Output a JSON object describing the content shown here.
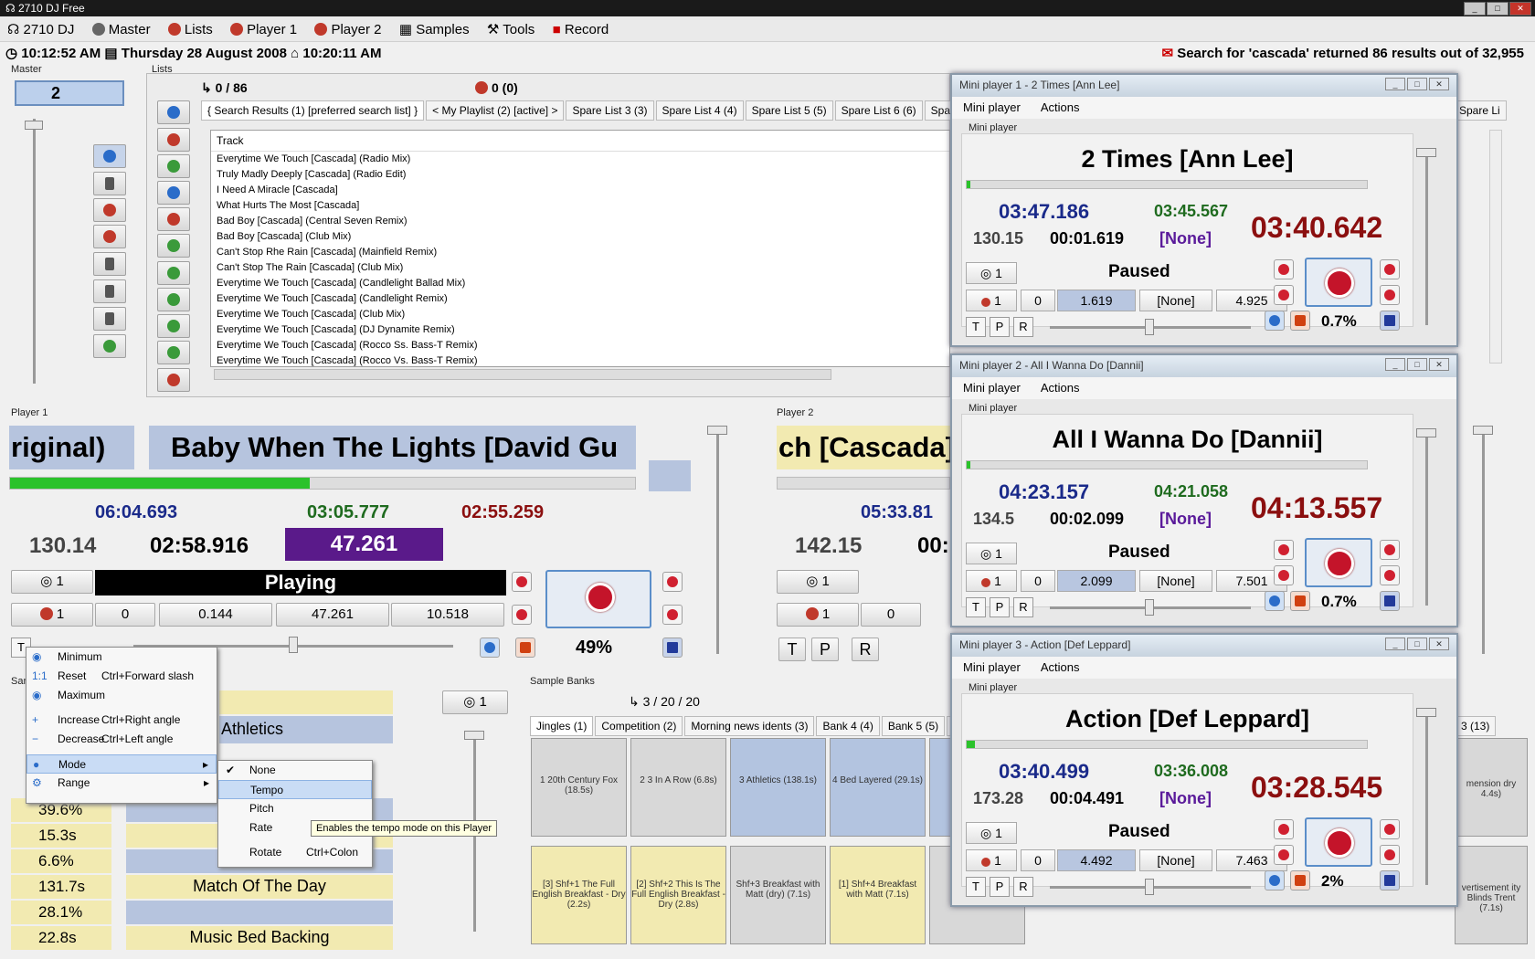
{
  "app": {
    "title": "2710 DJ Free"
  },
  "menu": [
    "2710 DJ",
    "Master",
    "Lists",
    "Player 1",
    "Player 2",
    "Samples",
    "Tools",
    "Record"
  ],
  "status": {
    "time1": "10:12:52 AM",
    "date": "Thursday 28 August 2008",
    "time2": "10:20:11 AM",
    "search": "Search for 'cascada' returned 86 results out of 32,955"
  },
  "master": {
    "label": "Master",
    "value": "2"
  },
  "lists": {
    "label": "Lists",
    "count": "0 / 86",
    "count2": "0 (0)",
    "tabs": [
      "{ Search Results (1) [preferred search list] }",
      "< My Playlist (2) [active] >",
      "Spare List 3 (3)",
      "Spare List 4 (4)",
      "Spare List 5 (5)",
      "Spare List 6 (6)",
      "Spare List"
    ],
    "tab_right": "Spare Li",
    "column": "Track",
    "tracks": [
      "Everytime We Touch [Cascada] (Radio Mix)",
      "Truly Madly Deeply [Cascada] (Radio Edit)",
      "I Need A Miracle [Cascada]",
      "What Hurts The Most [Cascada]",
      "Bad Boy [Cascada] (Central Seven Remix)",
      "Bad Boy [Cascada] (Club Mix)",
      "Can't Stop Rhe Rain [Cascada] (Mainfield Remix)",
      "Can't Stop The Rain [Cascada] (Club Mix)",
      "Everytime We Touch [Cascada] (Candlelight Ballad Mix)",
      "Everytime We Touch [Cascada] (Candlelight Remix)",
      "Everytime We Touch [Cascada] (Club Mix)",
      "Everytime We Touch [Cascada] (DJ Dynamite Remix)",
      "Everytime We Touch [Cascada] (Rocco Ss. Bass-T Remix)",
      "Everytime We Touch [Cascada] (Rocco Vs. Bass-T Remix)"
    ]
  },
  "player1": {
    "label": "Player 1",
    "title_left": "riginal)",
    "title": "Baby When The Lights [David Gu",
    "progress": 0.48,
    "t1": "06:04.693",
    "t2": "03:05.777",
    "bpm": "130.14",
    "t3": "02:58.916",
    "cue": "47.261",
    "remain": "02:55.259",
    "cue_num": "1",
    "state": "Playing",
    "c1": "1",
    "c2": "0",
    "c3": "0.144",
    "c4": "47.261",
    "c5": "10.518",
    "percent": "49%",
    "tpr": [
      "T",
      "P",
      "R"
    ]
  },
  "player2": {
    "label": "Player 2",
    "title": "ch [Cascada]",
    "t1": "05:33.81",
    "bpm": "142.15",
    "t3": "00:",
    "cue_num": "1",
    "c1": "1",
    "c2": "0",
    "tpr": [
      "T",
      "P",
      "R"
    ]
  },
  "minis": [
    {
      "wtitle": "Mini player 1 - 2 Times [Ann Lee]",
      "title": "2 Times [Ann Lee]",
      "t1": "03:47.186",
      "t2": "03:45.567",
      "bpm": "130.15",
      "t3": "00:01.619",
      "none": "[None]",
      "remain": "03:40.642",
      "cue": "1",
      "state": "Paused",
      "c1": "1",
      "c2": "0",
      "c3": "1.619",
      "c4": "[None]",
      "c5": "4.925",
      "pct": "0.7%"
    },
    {
      "wtitle": "Mini player 2 - All I Wanna Do [Dannii]",
      "title": "All I Wanna Do [Dannii]",
      "t1": "04:23.157",
      "t2": "04:21.058",
      "bpm": "134.5",
      "t3": "00:02.099",
      "none": "[None]",
      "remain": "04:13.557",
      "cue": "1",
      "state": "Paused",
      "c1": "1",
      "c2": "0",
      "c3": "2.099",
      "c4": "[None]",
      "c5": "7.501",
      "pct": "0.7%"
    },
    {
      "wtitle": "Mini player 3 - Action [Def Leppard]",
      "title": "Action [Def Leppard]",
      "t1": "03:40.499",
      "t2": "03:36.008",
      "bpm": "173.28",
      "t3": "00:04.491",
      "none": "[None]",
      "remain": "03:28.545",
      "cue": "1",
      "state": "Paused",
      "c1": "1",
      "c2": "0",
      "c3": "4.492",
      "c4": "[None]",
      "c5": "7.463",
      "pct": "2%"
    }
  ],
  "mini_menu": {
    "m1": "Mini player",
    "m2": "Actions",
    "sub": "Mini player",
    "tpr": [
      "T",
      "P",
      "R"
    ]
  },
  "context": {
    "items": [
      {
        "label": "Minimum",
        "sc": ""
      },
      {
        "label": "Reset",
        "sc": "Ctrl+Forward slash"
      },
      {
        "label": "Maximum",
        "sc": ""
      },
      {
        "label": "Increase",
        "sc": "Ctrl+Right angle"
      },
      {
        "label": "Decrease",
        "sc": "Ctrl+Left angle"
      },
      {
        "label": "Mode",
        "sc": ""
      },
      {
        "label": "Range",
        "sc": ""
      }
    ],
    "sub": [
      {
        "label": "None"
      },
      {
        "label": "Tempo"
      },
      {
        "label": "Pitch"
      },
      {
        "label": "Rate"
      },
      {
        "label": "Rotate",
        "sc": "Ctrl+Colon"
      }
    ],
    "tip": "Enables the tempo mode on this Player"
  },
  "samples_left": {
    "label": "San",
    "rows": [
      {
        "v": "39.6%",
        "n": ""
      },
      {
        "v": "15.3s",
        "n": ""
      },
      {
        "v": "6.6%",
        "n": ""
      },
      {
        "v": "131.7s",
        "n": "Match Of The Day"
      },
      {
        "v": "28.1%",
        "n": ""
      },
      {
        "v": "22.8s",
        "n": "Music Bed Backing"
      }
    ],
    "athletics": "Athletics",
    "cue": "1"
  },
  "sample_banks": {
    "label": "Sample Banks",
    "count": "3 / 20 / 20",
    "tabs": [
      "Jingles (1)",
      "Competition (2)",
      "Morning news idents (3)",
      "Bank 4 (4)",
      "Bank 5 (5)",
      "Ba"
    ],
    "tab_right": "3 (13)",
    "row1": [
      "1 20th Century Fox (18.5s)",
      "2 3 In A Row (6.8s)",
      "3 Athletics (138.1s)",
      "4 Bed Layered (29.1s)",
      "5 B"
    ],
    "row2": [
      "[3] Shf+1 The Full English Breakfast - Dry (2.2s)",
      "[2] Shf+2 This Is The Full English Breakfast - Dry (2.8s)",
      "Shf+3 Breakfast with Matt (dry) (7.1s)",
      "[1] Shf+4 Breakfast with Matt (7.1s)",
      "Shf"
    ],
    "right1": "mension dry 4.4s)",
    "right2": "vertisement ity Blinds Trent (7.1s)"
  }
}
